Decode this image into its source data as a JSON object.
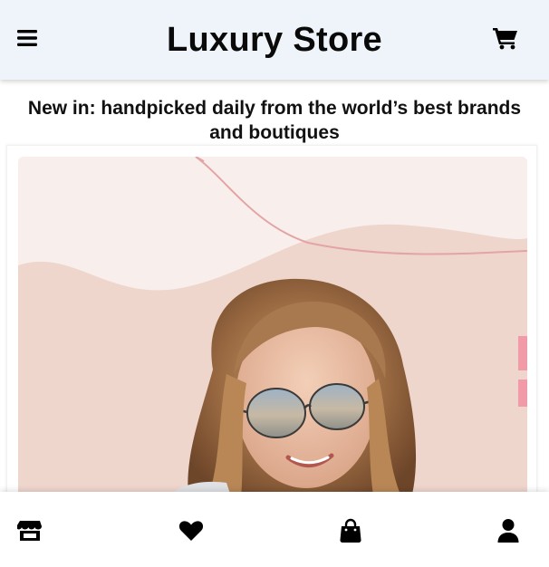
{
  "header": {
    "title": "Luxury Store",
    "menu_icon": "hamburger-menu-icon",
    "cart_icon": "shopping-cart-icon"
  },
  "tagline": "New in: handpicked daily from the world’s best brands and boutiques",
  "hero": {
    "image": "woman-with-mirrored-sunglasses-photo"
  },
  "bottom_nav": {
    "items": [
      {
        "icon": "store-icon"
      },
      {
        "icon": "heart-icon"
      },
      {
        "icon": "shopping-bag-icon"
      },
      {
        "icon": "user-icon"
      }
    ]
  },
  "colors": {
    "header_bg": "#eef4f9",
    "icon": "#000000",
    "hero_bg": "#f7ecea"
  }
}
